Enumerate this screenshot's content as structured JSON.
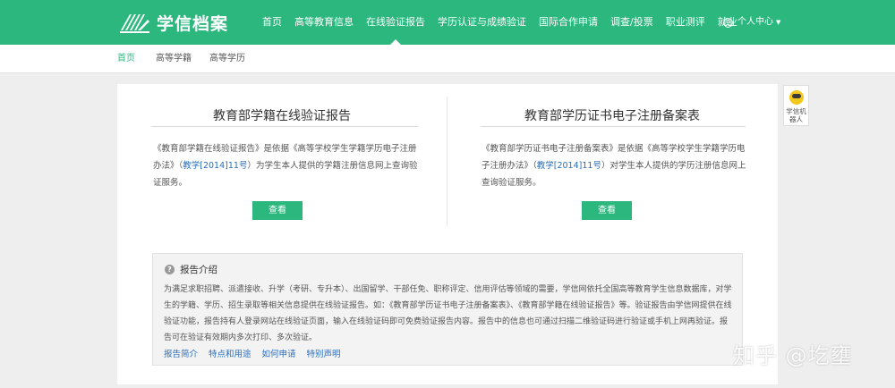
{
  "header": {
    "logo_text": "学信档案",
    "nav": [
      {
        "label": "首页"
      },
      {
        "label": "高等教育信息"
      },
      {
        "label": "在线验证报告",
        "active": true
      },
      {
        "label": "学历认证与成绩验证"
      },
      {
        "label": "国际合作申请"
      },
      {
        "label": "调查/投票"
      },
      {
        "label": "职业测评"
      },
      {
        "label": "就业"
      }
    ],
    "user_center": "个人中心"
  },
  "subnav": {
    "home": "首页",
    "item1": "高等学籍",
    "item2": "高等学历"
  },
  "cards": [
    {
      "title": "教育部学籍在线验证报告",
      "desc_before": "《教育部学籍在线验证报告》是依据《高等学校学生学籍学历电子注册办法》（",
      "desc_link": "教学[2014]11号",
      "desc_after": "）为学生本人提供的学籍注册信息网上查询验证服务。",
      "button": "查看"
    },
    {
      "title": "教育部学历证书电子注册备案表",
      "desc_before": "《教育部学历证书电子注册备案表》是依据《高等学校学生学籍学历电子注册办法》（",
      "desc_link": "教学[2014]11号",
      "desc_after": "）对学生本人提供的学历注册信息网上查询验证服务。",
      "button": "查看"
    }
  ],
  "intro": {
    "title": "报告介绍",
    "text": "为满足求职招聘、派遣接收、升学（考研、专升本）、出国留学、干部任免、职称评定、信用评估等领域的需要，学信网依托全国高等教育学生信息数据库，对学生的学籍、学历、招生录取等相关信息提供在线验证报告。如：《教育部学历证书电子注册备案表》、《教育部学籍在线验证报告》等。验证报告由学信网提供在线验证功能，报告持有人登录网站在线验证页面，输入在线验证码即可免费验证报告内容。报告中的信息也可通过扫描二维验证码进行验证或手机上网再验证。报告可在验证有效期内多次打印、多次验证。",
    "links": [
      "报告简介",
      "特点和用途",
      "如何申请",
      "特别声明"
    ]
  },
  "robot": {
    "label": "学信机器人"
  },
  "watermark": "知乎 @圪壅",
  "colors": {
    "brand_green": "#2bb77e",
    "link_blue": "#2a6ebb",
    "page_bg": "#eeeeee"
  },
  "icons": {
    "logo": "book-pages-icon",
    "user": "user-circle-icon",
    "caret": "caret-down-icon",
    "intro": "question-circle-icon",
    "robot": "robot-face-icon"
  }
}
